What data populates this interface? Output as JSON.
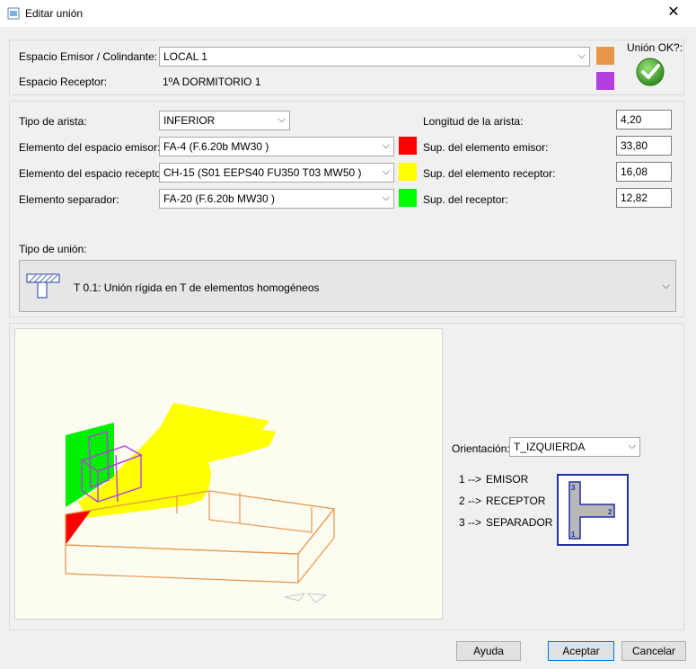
{
  "window": {
    "title": "Editar unión"
  },
  "spaces": {
    "emisor_label": "Espacio Emisor / Colindante:",
    "emisor_value": "LOCAL 1",
    "emisor_color": "#e8964a",
    "receptor_label": "Espacio Receptor:",
    "receptor_value": "1ºA DORMITORIO 1",
    "receptor_color": "#b43fe0",
    "ok_label": "Unión OK?:",
    "ok_icon": "check-icon"
  },
  "elements": {
    "tipo_arista_label": "Tipo de arista:",
    "tipo_arista_value": "INFERIOR",
    "emisor_label": "Elemento del espacio emisor:",
    "emisor_value": "FA-4 (F.6.20b MW30 )",
    "emisor_color": "#ff0000",
    "receptor_label": "Elemento del espacio receptor:",
    "receptor_value": "CH-15 (S01 EEPS40 FU350 T03 MW50 )",
    "receptor_color": "#ffff00",
    "separador_label": "Elemento separador:",
    "separador_value": "FA-20 (F.6.20b MW30 )",
    "separador_color": "#00ff00",
    "longitud_label": "Longitud de la arista:",
    "longitud_value": "4,20",
    "sup_emisor_label": "Sup. del elemento emisor:",
    "sup_emisor_value": "33,80",
    "sup_receptor_el_label": "Sup. del elemento receptor:",
    "sup_receptor_el_value": "16,08",
    "sup_receptor_label": "Sup. del receptor:",
    "sup_receptor_value": "12,82",
    "tipo_union_label": "Tipo de unión:",
    "tipo_union_value": "T 0.1: Unión rígida en T de elementos homogéneos"
  },
  "orientation": {
    "label": "Orientación:",
    "value": "T_IZQUIERDA",
    "legend": [
      {
        "key": "1 -->",
        "value": "EMISOR"
      },
      {
        "key": "2 -->",
        "value": "RECEPTOR"
      },
      {
        "key": "3 -->",
        "value": "SEPARADOR"
      }
    ],
    "diagram_labels": [
      "3",
      "2",
      "1"
    ]
  },
  "buttons": {
    "help": "Ayuda",
    "accept": "Aceptar",
    "cancel": "Cancelar"
  }
}
